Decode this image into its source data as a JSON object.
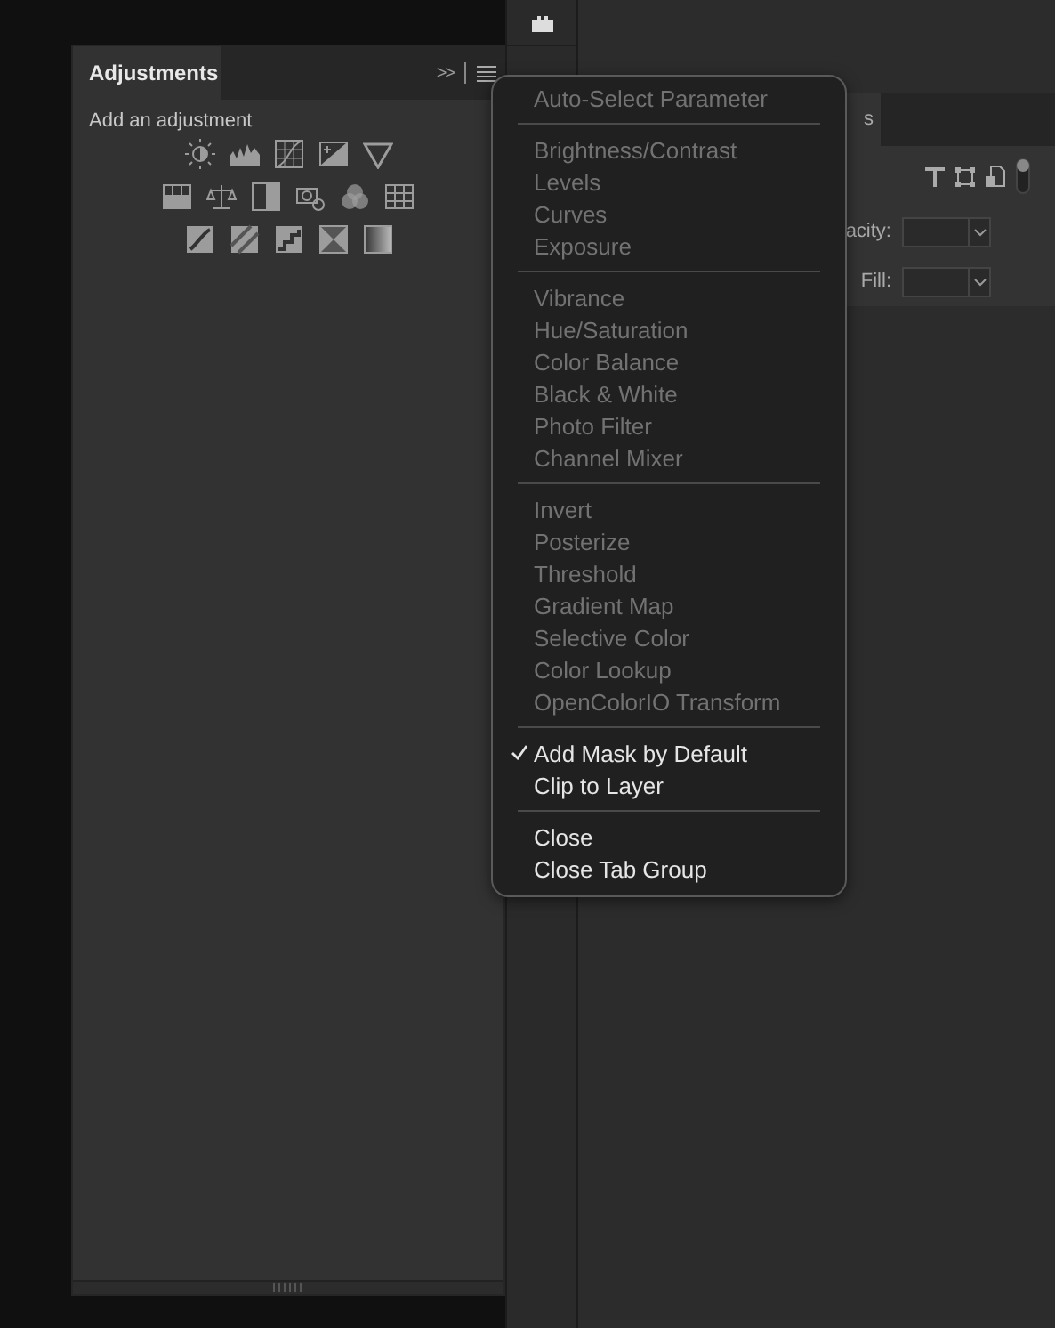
{
  "adjustments_panel": {
    "tab": "Adjustments",
    "collapse_button": ">>",
    "subtitle": "Add an adjustment"
  },
  "layers_panel": {
    "tab": "s",
    "opacity_label": "acity:",
    "fill_label": "Fill:"
  },
  "menu": {
    "groups": [
      [
        {
          "label": "Auto-Select Parameter",
          "disabled": true,
          "checked": false
        }
      ],
      [
        {
          "label": "Brightness/Contrast",
          "disabled": true,
          "checked": false
        },
        {
          "label": "Levels",
          "disabled": true,
          "checked": false
        },
        {
          "label": "Curves",
          "disabled": true,
          "checked": false
        },
        {
          "label": "Exposure",
          "disabled": true,
          "checked": false
        }
      ],
      [
        {
          "label": "Vibrance",
          "disabled": true,
          "checked": false
        },
        {
          "label": "Hue/Saturation",
          "disabled": true,
          "checked": false
        },
        {
          "label": "Color Balance",
          "disabled": true,
          "checked": false
        },
        {
          "label": "Black & White",
          "disabled": true,
          "checked": false
        },
        {
          "label": "Photo Filter",
          "disabled": true,
          "checked": false
        },
        {
          "label": "Channel Mixer",
          "disabled": true,
          "checked": false
        }
      ],
      [
        {
          "label": "Invert",
          "disabled": true,
          "checked": false
        },
        {
          "label": "Posterize",
          "disabled": true,
          "checked": false
        },
        {
          "label": "Threshold",
          "disabled": true,
          "checked": false
        },
        {
          "label": "Gradient Map",
          "disabled": true,
          "checked": false
        },
        {
          "label": "Selective Color",
          "disabled": true,
          "checked": false
        },
        {
          "label": "Color Lookup",
          "disabled": true,
          "checked": false
        },
        {
          "label": "OpenColorIO Transform",
          "disabled": true,
          "checked": false
        }
      ],
      [
        {
          "label": "Add Mask by Default",
          "disabled": false,
          "checked": true
        },
        {
          "label": "Clip to Layer",
          "disabled": false,
          "checked": false
        }
      ],
      [
        {
          "label": "Close",
          "disabled": false,
          "checked": false
        },
        {
          "label": "Close Tab Group",
          "disabled": false,
          "checked": false
        }
      ]
    ]
  }
}
